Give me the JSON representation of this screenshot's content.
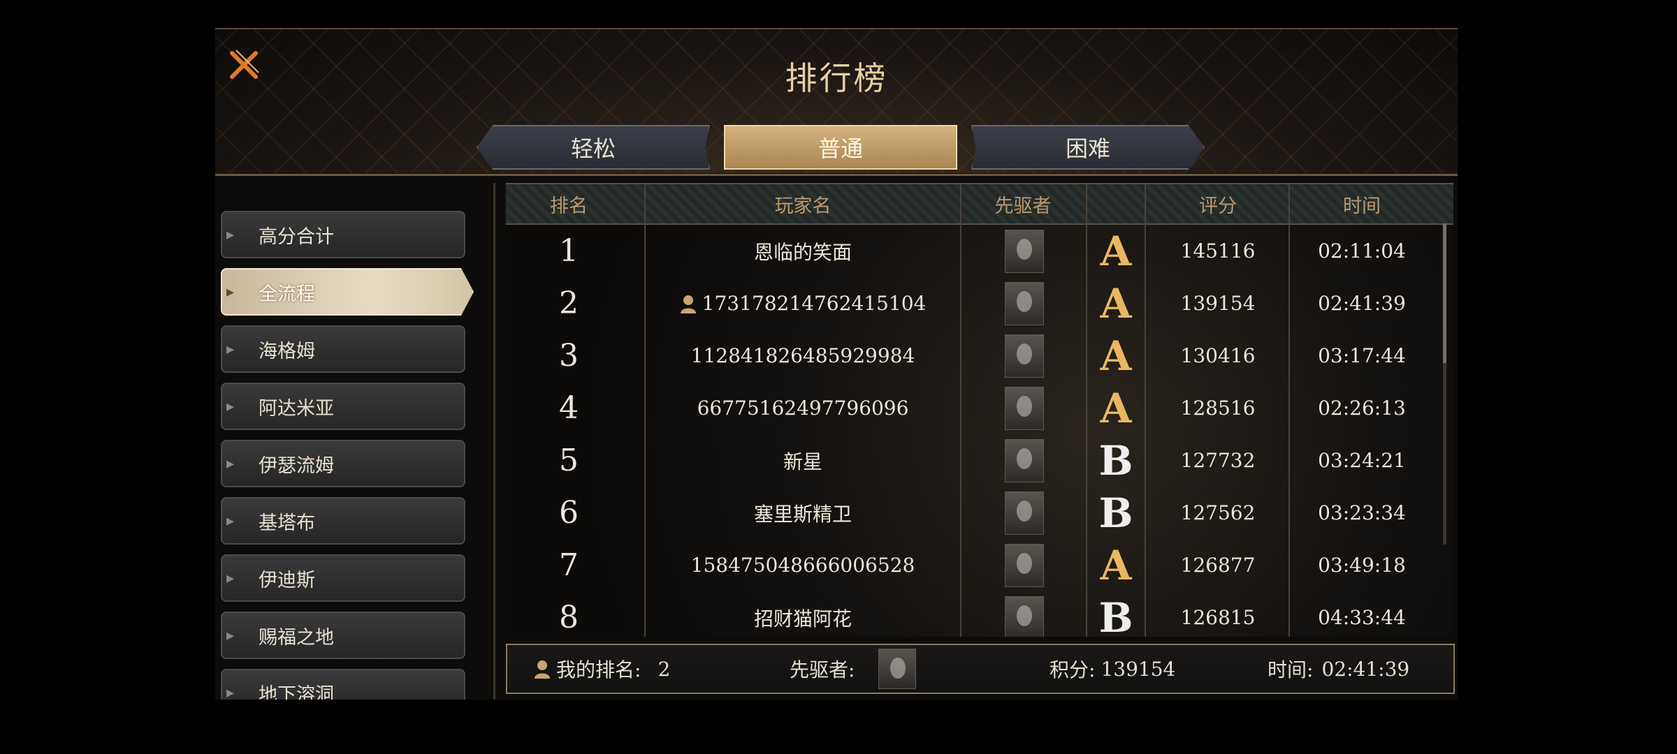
{
  "title": "排行榜",
  "tabs": [
    {
      "label": "轻松"
    },
    {
      "label": "普通"
    },
    {
      "label": "困难"
    }
  ],
  "active_tab": "普通",
  "sidebar": {
    "items": [
      {
        "label": "高分合计"
      },
      {
        "label": "全流程"
      },
      {
        "label": "海格姆"
      },
      {
        "label": "阿达米亚"
      },
      {
        "label": "伊瑟流姆"
      },
      {
        "label": "基塔布"
      },
      {
        "label": "伊迪斯"
      },
      {
        "label": "赐福之地"
      },
      {
        "label": "地下溶洞"
      }
    ],
    "active": "全流程"
  },
  "table": {
    "headers": {
      "rank": "排名",
      "player": "玩家名",
      "pioneer": "先驱者",
      "score": "评分",
      "time": "时间"
    },
    "rows": [
      {
        "rank": "1",
        "player": "恩临的笑面",
        "grade": "A",
        "score": "145116",
        "time": "02:11:04",
        "self": false
      },
      {
        "rank": "2",
        "player": "173178214762415104",
        "grade": "A",
        "score": "139154",
        "time": "02:41:39",
        "self": true
      },
      {
        "rank": "3",
        "player": "112841826485929984",
        "grade": "A",
        "score": "130416",
        "time": "03:17:44",
        "self": false
      },
      {
        "rank": "4",
        "player": "66775162497796096",
        "grade": "A",
        "score": "128516",
        "time": "02:26:13",
        "self": false
      },
      {
        "rank": "5",
        "player": "新星",
        "grade": "B",
        "score": "127732",
        "time": "03:24:21",
        "self": false
      },
      {
        "rank": "6",
        "player": "塞里斯精卫",
        "grade": "B",
        "score": "127562",
        "time": "03:23:34",
        "self": false
      },
      {
        "rank": "7",
        "player": "158475048666006528",
        "grade": "A",
        "score": "126877",
        "time": "03:49:18",
        "self": false
      },
      {
        "rank": "8",
        "player": "招财猫阿花",
        "grade": "B",
        "score": "126815",
        "time": "04:33:44",
        "self": false
      }
    ]
  },
  "footer": {
    "my_rank_label": "我的排名:",
    "my_rank_value": "2",
    "pioneer_label": "先驱者:",
    "score_label": "积分:",
    "score_value": "139154",
    "time_label": "时间:",
    "time_value": "02:41:39"
  },
  "icons": {
    "close": "close-x-icon",
    "user": "user-icon",
    "chevron": "chevron-right-icon"
  },
  "colors": {
    "accent_gold": "#e8b860",
    "tab_active": "#c8a46e",
    "header_text": "#b99a70"
  }
}
